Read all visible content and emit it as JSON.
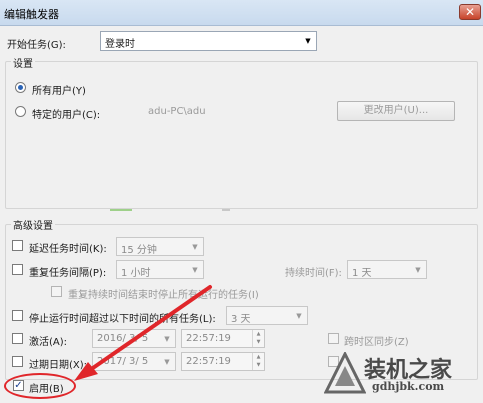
{
  "window": {
    "title": "编辑触发器",
    "close_glyph": "✕"
  },
  "begin_task": {
    "label": "开始任务(G):",
    "value": "登录时"
  },
  "settings": {
    "title": "设置",
    "all_users_label": "所有用户(Y)",
    "specific_user_label": "特定的用户(C):",
    "user_value": "adu-PC\\adu",
    "change_user_button": "更改用户(U)...",
    "selected": "all_users"
  },
  "advanced": {
    "title": "高级设置",
    "delay": {
      "label": "延迟任务时间(K):",
      "value": "15 分钟",
      "checked": false
    },
    "repeat": {
      "label": "重复任务间隔(P):",
      "value": "1 小时",
      "checked": false
    },
    "duration": {
      "label": "持续时间(F):",
      "value": "1 天"
    },
    "stop_repeat": {
      "label": "重复持续时间结束时停止所有运行的任务(I)",
      "checked": false
    },
    "stop_if_longer": {
      "label": "停止运行时间超过以下时间的所有任务(L):",
      "value": "3 天",
      "checked": false
    },
    "activate": {
      "label": "激活(A):",
      "date": "2016/ 3/ 5",
      "time": "22:57:19",
      "checked": false
    },
    "sync_tz": {
      "label": "跨时区同步(Z)",
      "checked": false
    },
    "expire": {
      "label": "过期日期(X):",
      "date": "2017/ 3/ 5",
      "time": "22:57:19",
      "checked": false
    },
    "enabled": {
      "label": "启用(B)",
      "checked": true
    }
  },
  "colors": {
    "annotation": "#e0262a"
  },
  "watermark": {
    "brand": "装机之家",
    "site": "gdhjbk.com"
  }
}
